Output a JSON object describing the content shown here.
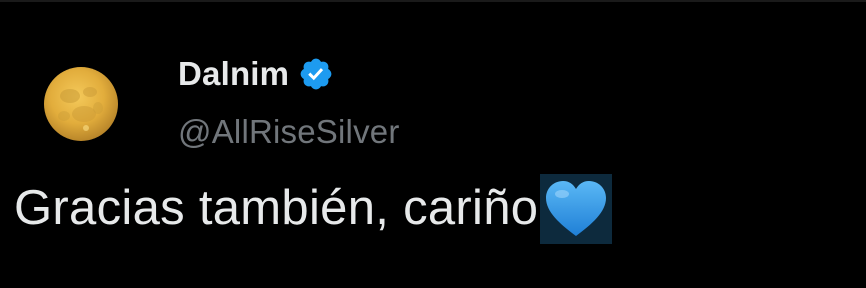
{
  "tweet": {
    "author": {
      "display_name": "Dalnim",
      "handle": "@AllRiseSilver",
      "verified": true,
      "avatar_icon": "full-moon-icon"
    },
    "text": "Gracias también, cariño",
    "emoji": "blue-heart-icon"
  },
  "colors": {
    "background": "#000000",
    "primary_text": "#e7e9ea",
    "secondary_text": "#71767b",
    "verified_badge": "#1d9bf0",
    "heart": "#2f8fe0"
  }
}
